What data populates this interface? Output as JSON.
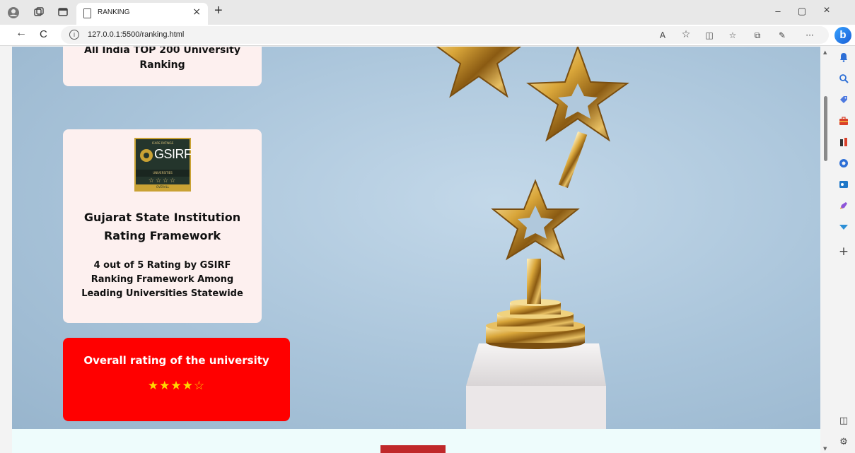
{
  "browser": {
    "tab_title": "RANKING",
    "tab_close": "×",
    "new_tab": "+",
    "url": "127.0.0.1:5500/ranking.html",
    "info_glyph": "i",
    "minimize": "–",
    "restore": "▢",
    "close": "×",
    "back": "←",
    "refresh": "C",
    "read_aloud": "A",
    "favorite": "☆",
    "split": "◫",
    "favorites": "☆",
    "collections": "⧉",
    "extensions": "✎",
    "more": "···",
    "copilot": "b"
  },
  "page": {
    "card1_title": "All India TOP 200 University Ranking",
    "card2_logo": {
      "top_text": "ICARE RATINGS",
      "name": "GSIRF",
      "band": "UNIVERSITIES",
      "stars": "☆☆☆☆",
      "foot": "OVERALL"
    },
    "card2_title": "Gujarat State Institution Rating Framework",
    "card2_desc": "4 out of 5 Rating by GSIRF Ranking Framework Among Leading Universities Statewide",
    "card3_title": "Overall rating of the university",
    "card3_stars": "★★★★☆"
  },
  "sidebar": {
    "add": "+",
    "panel": "◫",
    "settings": "⚙"
  },
  "colors": {
    "card_bg": "#fdf0ef",
    "rating_card_bg": "#ff0000",
    "star_color": "#ffd700",
    "hero_bg": "#a9c4da",
    "bottom_button": "#c0282a"
  }
}
